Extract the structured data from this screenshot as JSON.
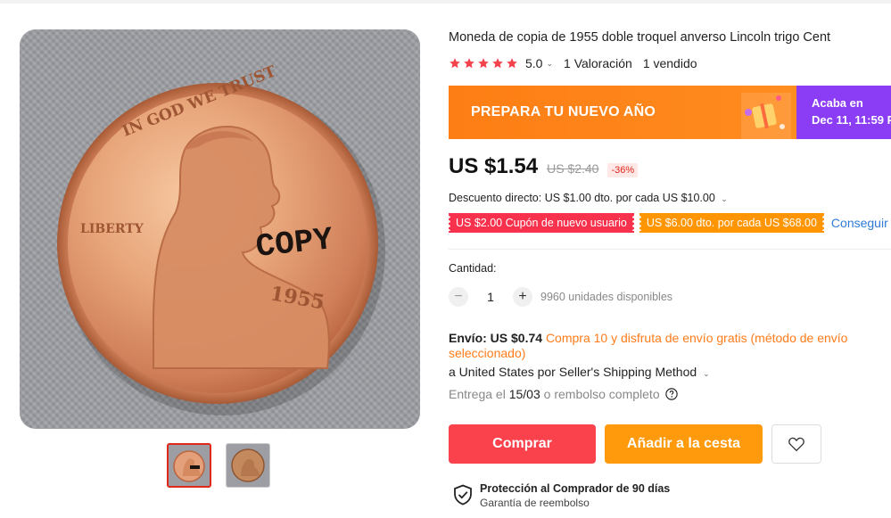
{
  "product": {
    "title": "Moneda de copia de 1955 doble troquel anverso Lincoln trigo Cent",
    "main_image": {
      "coin_top_text": "IN GOD WE TRUST",
      "coin_side_text": "LIBERTY",
      "coin_stamp_text": "COPY",
      "coin_year_text": "1955"
    }
  },
  "rating": {
    "value": "5.0",
    "star_count": 5,
    "reviews": "1 Valoración",
    "sold": "1 vendido",
    "star_color": "#f5424b"
  },
  "promo": {
    "title": "PREPARA TU NUEVO AÑO",
    "ends_label": "Acaba en",
    "ends_date": "Dec 11, 11:59 P"
  },
  "price": {
    "current": "US $1.54",
    "original": "US $2.40",
    "discount": "-36%"
  },
  "direct_discount": "Descuento directo: US $1.00 dto. por cada US $10.00",
  "coupons": [
    {
      "text": "US $2.00 Cupón de nuevo usuario",
      "color": "#f8324d"
    },
    {
      "text": "US $6.00 dto. por cada US $68.00",
      "color": "#ff9500"
    }
  ],
  "get_coupons_label": "Conseguir c",
  "quantity": {
    "label": "Cantidad:",
    "minus": "−",
    "value": "1",
    "plus": "+",
    "available": "9960 unidades disponibles"
  },
  "shipping": {
    "label": "Envío: US $0.74",
    "promo": "Compra 10 y disfruta de envío gratis (método de envío seleccionado)",
    "method": "a United States por Seller's Shipping Method",
    "delivery_prefix": "Entrega el",
    "delivery_date": "15/03",
    "delivery_suffix": "o rembolso completo"
  },
  "actions": {
    "buy": "Comprar",
    "add_to_cart": "Añadir a la cesta"
  },
  "protection": {
    "title": "Protección al Comprador de 90 días",
    "subtitle": "Garantía de reembolso"
  }
}
